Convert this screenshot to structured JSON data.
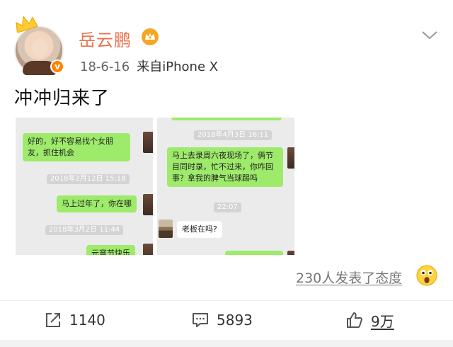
{
  "post": {
    "username": "岳云鹏",
    "date": "18-6-16",
    "source": "来自iPhone X",
    "text": "冲冲归来了",
    "avatar_badge": "v"
  },
  "screenshot_left": {
    "bubble1": "好的，好不容易找个女朋友，抓住机会",
    "time1": "2018年2月12日 15:18",
    "bubble2": "马上过年了，你在哪",
    "time2": "2018年3月2日 11:44",
    "bubble3": "元宵节快乐"
  },
  "screenshot_right": {
    "time1": "2018年4月3日 16:11",
    "bubble1": "马上去录周六夜现场了，俩节目同时录，忙不过来，你咋回事？拿我的脾气当球踢吗",
    "time2": "22:07",
    "bubble2": "老板在吗?"
  },
  "footer": {
    "attitude_text": "230人发表了态度",
    "repost_count": "1140",
    "comment_count": "5893",
    "like_count": "9万"
  },
  "icons": {
    "crown": "crown-icon",
    "vip": "vip-crown-icon",
    "more": "chevron-down-icon",
    "emoji": "surprised-face-icon",
    "repost": "repost-icon",
    "comment": "comment-icon",
    "like": "thumbs-up-icon"
  },
  "colors": {
    "username": "#eb7350",
    "vip_crown": "#f5a623",
    "chat_green": "#9eea6a",
    "verify_badge": "#ff8200"
  }
}
